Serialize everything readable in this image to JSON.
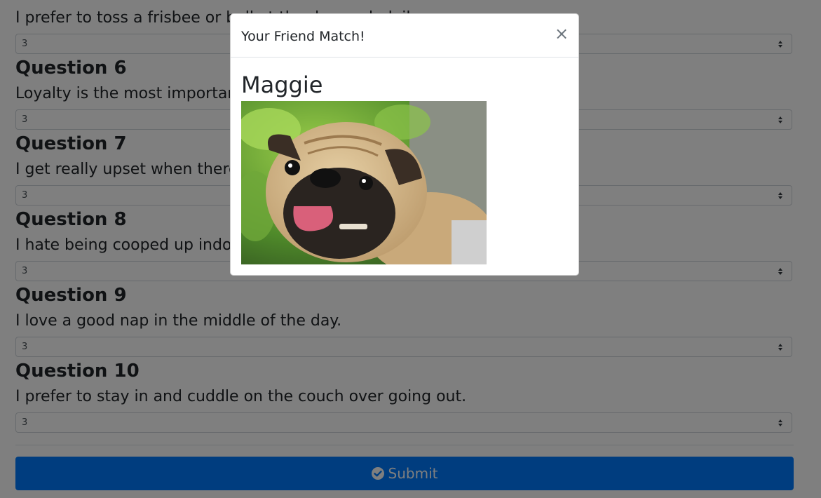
{
  "questions": [
    {
      "title": "",
      "text": "I prefer to toss a frisbee or ball at the dog park daily.",
      "value": "3"
    },
    {
      "title": "Question 6",
      "text": "Loyalty is the most important quality in a friend.",
      "value": "3"
    },
    {
      "title": "Question 7",
      "text": "I get really upset when there is a thunderstorm.",
      "value": "3"
    },
    {
      "title": "Question 8",
      "text": "I hate being cooped up indoors all day.",
      "value": "3"
    },
    {
      "title": "Question 9",
      "text": "I love a good nap in the middle of the day.",
      "value": "3"
    },
    {
      "title": "Question 10",
      "text": "I prefer to stay in and cuddle on the couch over going out.",
      "value": "3"
    }
  ],
  "submit_label": "Submit",
  "modal": {
    "title": "Your Friend Match!",
    "close_symbol": "×",
    "friend_name": "Maggie",
    "photo_icon": "pug-photo"
  },
  "colors": {
    "primary": "#007bff",
    "backdrop": "#000000"
  }
}
